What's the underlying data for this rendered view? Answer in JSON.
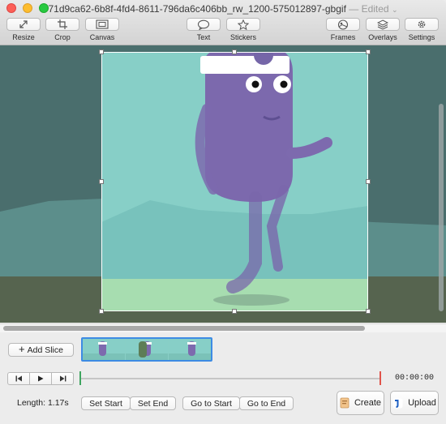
{
  "window": {
    "title": "71d9ca62-6b8f-4fd4-8611-796da6c406bb_rw_1200-575012897-gbgif",
    "edited_label": "— Edited",
    "edited_chevron": "⌄"
  },
  "toolbar": {
    "resize": "Resize",
    "crop": "Crop",
    "canvas": "Canvas",
    "text": "Text",
    "stickers": "Stickers",
    "frames": "Frames",
    "overlays": "Overlays",
    "settings": "Settings"
  },
  "slices": {
    "add_slice": "Add Slice",
    "add_slice_glyph": "+"
  },
  "playback": {
    "timecode": "00:00:00"
  },
  "footer": {
    "length": "Length: 1.17s",
    "set_start": "Set Start",
    "set_end": "Set End",
    "go_to_start": "Go to Start",
    "go_to_end": "Go to End",
    "create": "Create",
    "upload": "Upload"
  },
  "colors": {
    "accent": "#3d8be4",
    "timeline_start": "#3fa55f",
    "timeline_end": "#e0534a",
    "character": "#7d6aae"
  }
}
